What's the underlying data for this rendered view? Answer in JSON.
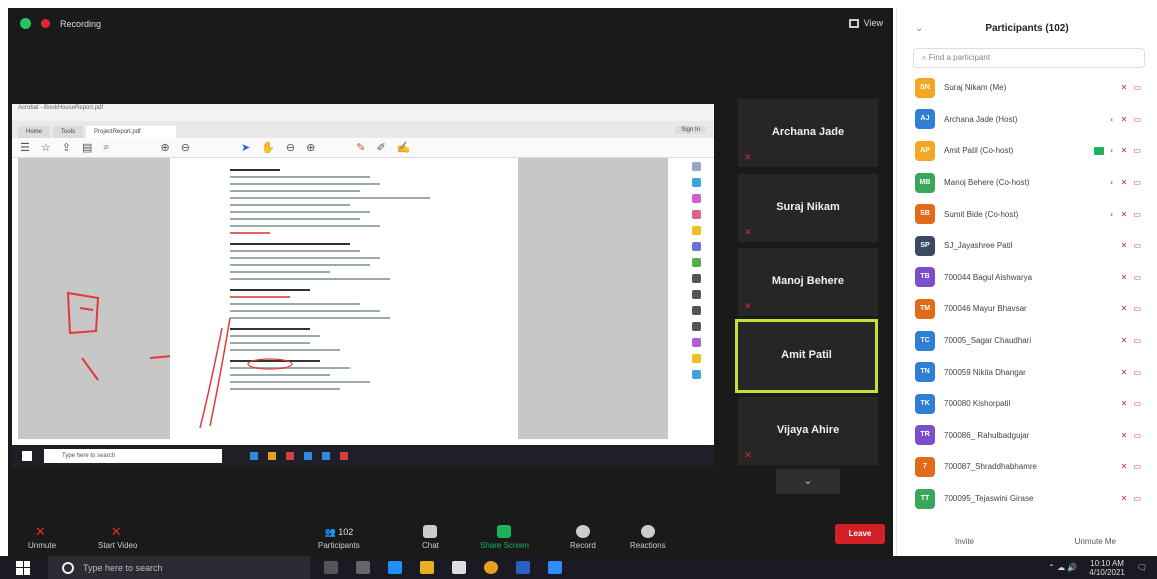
{
  "meeting": {
    "recording_label": "Recording",
    "view_label": "View",
    "tiles": [
      {
        "name": "Archana Jade",
        "active": false
      },
      {
        "name": "Suraj Nikam",
        "active": false
      },
      {
        "name": "Manoj Behere",
        "active": false
      },
      {
        "name": "Amit Patil",
        "active": true
      },
      {
        "name": "Vijaya Ahire",
        "active": false
      }
    ],
    "tiles_more_icon": "chevron-down-icon",
    "controls": {
      "unmute": "Unmute",
      "start_video": "Start Video",
      "participants": "Participants",
      "participants_count": "102",
      "chat": "Chat",
      "share_screen": "Share Screen",
      "record": "Record",
      "reactions": "Reactions",
      "leave": "Leave"
    },
    "accent_colors": {
      "leave": "#d32027",
      "share": "#1db15a",
      "active_tile": "#c6e03a"
    }
  },
  "shared_screen": {
    "window_title": "Acrobat - BookHouseReport.pdf",
    "tabs": [
      "Home",
      "Tools",
      "ProjectReport.pdf"
    ],
    "sign_in": "Sign In",
    "taskbar_search": "Type here to search",
    "toc": [
      "1 Introduction",
      "2 System Requirement Analysis",
      "3 Feasibility Study",
      "4 Proposed System",
      "5 Preliminary Design"
    ]
  },
  "panel": {
    "title": "Participants (102)",
    "search_placeholder": "Find a participant",
    "participants": [
      {
        "initials": "SN",
        "name": "Suraj Nikam (Me)",
        "color": "#f5a623",
        "video": false,
        "extra": false
      },
      {
        "initials": "AJ",
        "name": "Archana Jade (Host)",
        "color": "#2d7fd3",
        "video": false,
        "extra": true
      },
      {
        "initials": "AP",
        "name": "Amit Patil (Co-host)",
        "color": "#f5a623",
        "video": true,
        "extra": true
      },
      {
        "initials": "MB",
        "name": "Manoj Behere (Co-host)",
        "color": "#3aa657",
        "video": false,
        "extra": true
      },
      {
        "initials": "SB",
        "name": "Sumit Bide (Co-host)",
        "color": "#e26b1a",
        "video": false,
        "extra": true
      },
      {
        "initials": "SP",
        "name": "SJ_Jayashree Patil",
        "color": "#3b4a63",
        "video": false,
        "extra": false
      },
      {
        "initials": "TB",
        "name": "700044 Bagul Aishwarya",
        "color": "#7b4fc9",
        "video": false,
        "extra": false
      },
      {
        "initials": "TM",
        "name": "700046 Mayur Bhavsar",
        "color": "#e26b1a",
        "video": false,
        "extra": false
      },
      {
        "initials": "TC",
        "name": "70005_Sagar Chaudhari",
        "color": "#2d7fd3",
        "video": false,
        "extra": false
      },
      {
        "initials": "TN",
        "name": "700059 Nikita Dhangar",
        "color": "#2d7fd3",
        "video": false,
        "extra": false
      },
      {
        "initials": "TK",
        "name": "700080 Kishorpatil",
        "color": "#2d7fd3",
        "video": false,
        "extra": false
      },
      {
        "initials": "TR",
        "name": "700086_ Rahulbadgujar",
        "color": "#7b4fc9",
        "video": false,
        "extra": false
      },
      {
        "initials": "7",
        "name": "700087_Shraddhabhamre",
        "color": "#e26b1a",
        "video": false,
        "extra": false
      },
      {
        "initials": "TT",
        "name": "700095_Tejaswini Girase",
        "color": "#3aa657",
        "video": false,
        "extra": false
      }
    ],
    "invite": "Invite",
    "unmute_me": "Unmute Me"
  },
  "taskbar": {
    "search_placeholder": "Type here to search",
    "time": "10:10 AM",
    "date": "4/10/2021"
  }
}
